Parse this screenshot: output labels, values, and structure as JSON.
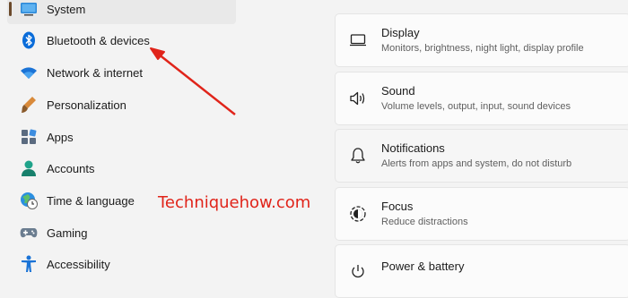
{
  "sidebar": {
    "items": [
      {
        "label": "System",
        "icon": "monitor-icon",
        "selected": true
      },
      {
        "label": "Bluetooth & devices",
        "icon": "bluetooth-icon"
      },
      {
        "label": "Network & internet",
        "icon": "wifi-icon"
      },
      {
        "label": "Personalization",
        "icon": "brush-icon"
      },
      {
        "label": "Apps",
        "icon": "apps-icon"
      },
      {
        "label": "Accounts",
        "icon": "person-icon"
      },
      {
        "label": "Time & language",
        "icon": "globe-clock-icon"
      },
      {
        "label": "Gaming",
        "icon": "gamepad-icon"
      },
      {
        "label": "Accessibility",
        "icon": "accessibility-icon"
      }
    ]
  },
  "settings": {
    "cards": [
      {
        "title": "Display",
        "subtitle": "Monitors, brightness, night light, display profile",
        "icon": "display-icon"
      },
      {
        "title": "Sound",
        "subtitle": "Volume levels, output, input, sound devices",
        "icon": "speaker-icon"
      },
      {
        "title": "Notifications",
        "subtitle": "Alerts from apps and system, do not disturb",
        "icon": "bell-icon"
      },
      {
        "title": "Focus",
        "subtitle": "Reduce distractions",
        "icon": "focus-icon"
      },
      {
        "title": "Power & battery",
        "subtitle": "",
        "icon": "power-icon"
      }
    ]
  },
  "watermark": "Techniquehow.com",
  "colors": {
    "accent_red": "#e0241a",
    "bluetooth_blue": "#0a6cd9",
    "selection_bar": "#6b4a2b"
  }
}
